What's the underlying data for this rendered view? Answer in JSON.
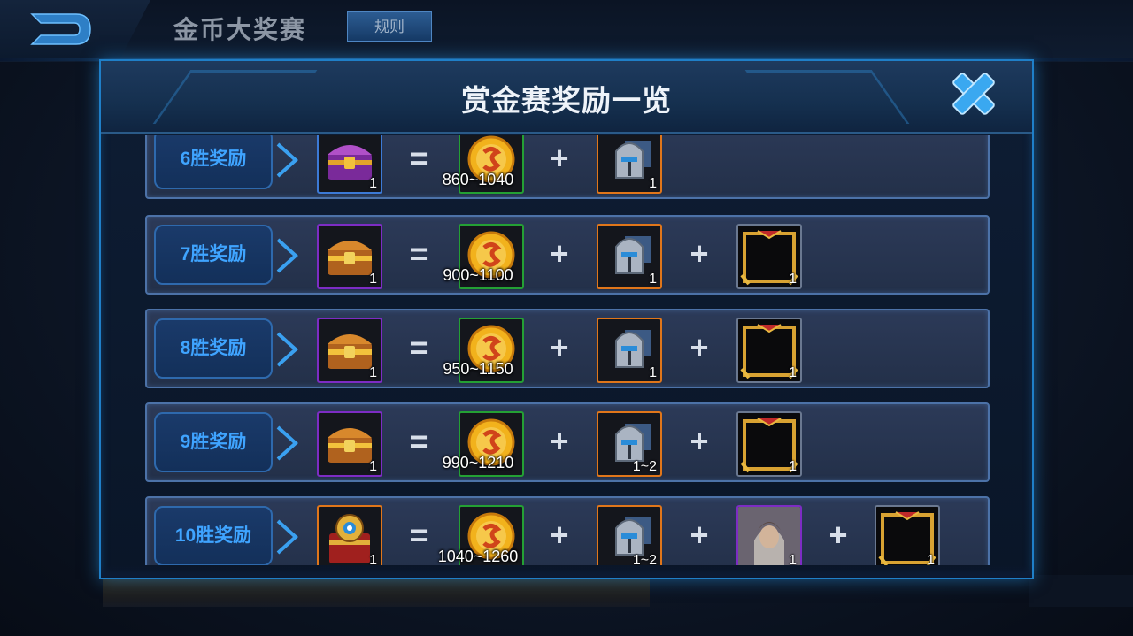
{
  "page": {
    "title": "金币大奖赛",
    "rules_label": "规则"
  },
  "modal": {
    "title": "赏金赛奖励一览"
  },
  "operators": {
    "equals": "=",
    "plus": "+"
  },
  "rows": [
    {
      "label": "6胜奖励",
      "chest": {
        "icon": "purple-treasure-chest-icon",
        "qty": "1"
      },
      "coins": "860~1040",
      "helmet_qty": "1",
      "frame_qty": "",
      "hero_qty": "",
      "frame2_qty": ""
    },
    {
      "label": "7胜奖励",
      "chest": {
        "icon": "gold-treasure-chest-icon",
        "qty": "1"
      },
      "coins": "900~1100",
      "helmet_qty": "1",
      "frame_qty": "1",
      "hero_qty": "",
      "frame2_qty": ""
    },
    {
      "label": "8胜奖励",
      "chest": {
        "icon": "gold-treasure-chest-icon",
        "qty": "1"
      },
      "coins": "950~1150",
      "helmet_qty": "1",
      "frame_qty": "1",
      "hero_qty": "",
      "frame2_qty": ""
    },
    {
      "label": "9胜奖励",
      "chest": {
        "icon": "gold-treasure-chest-icon",
        "qty": "1"
      },
      "coins": "990~1210",
      "helmet_qty": "1~2",
      "frame_qty": "1",
      "hero_qty": "",
      "frame2_qty": ""
    },
    {
      "label": "10胜奖励",
      "chest": {
        "icon": "royal-treasure-chest-icon",
        "qty": "1"
      },
      "coins": "1040~1260",
      "helmet_qty": "1~2",
      "frame_qty": "",
      "hero_qty": "1",
      "frame2_qty": "1"
    }
  ],
  "colors": {
    "accent_blue": "#1f7fc8",
    "label_text": "#3fa4ff",
    "coin_gold": "#f2b21c",
    "border_purple": "#7d2cc4",
    "border_green": "#24a034",
    "border_orange": "#e0761a"
  }
}
